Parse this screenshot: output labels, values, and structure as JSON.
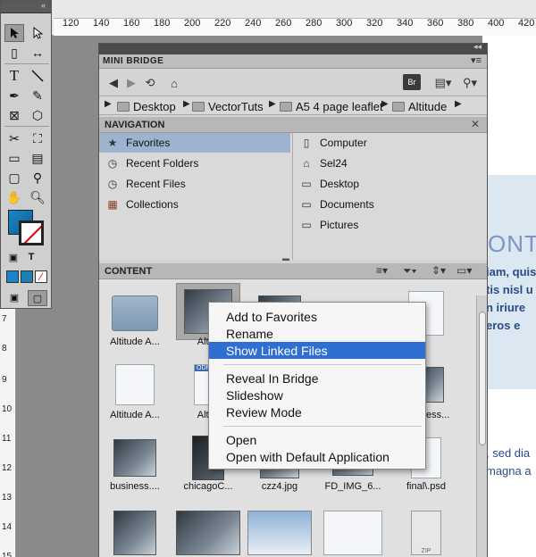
{
  "ruler": {
    "top_labels": [
      "120",
      "140",
      "160",
      "180",
      "200",
      "220",
      "240",
      "260",
      "280",
      "300",
      "320",
      "340",
      "360",
      "380",
      "400",
      "420"
    ],
    "left_labels": [
      "7",
      "8",
      "9",
      "10",
      "11",
      "12",
      "13",
      "14",
      "15"
    ]
  },
  "document": {
    "heading": "ONTO",
    "para1": [
      "iam, quis",
      "tis nisl u",
      "n iriure",
      "eros e"
    ],
    "para2": [
      ", sed dia",
      "magna a"
    ]
  },
  "tools": {
    "type_icon": "T",
    "text_icon": "T"
  },
  "mini_bridge": {
    "title": "MINI BRIDGE",
    "br_button": "Br",
    "breadcrumbs": [
      "Desktop",
      "VectorTuts",
      "A5 4 page leaflet",
      "Altitude"
    ],
    "navigation": {
      "header": "NAVIGATION",
      "left": [
        {
          "label": "Favorites",
          "icon": "star-icon",
          "selected": true
        },
        {
          "label": "Recent Folders",
          "icon": "clock-icon",
          "selected": false
        },
        {
          "label": "Recent Files",
          "icon": "clock-icon",
          "selected": false
        },
        {
          "label": "Collections",
          "icon": "collection-icon",
          "selected": false
        }
      ],
      "right": [
        {
          "label": "Computer",
          "icon": "computer-icon"
        },
        {
          "label": "Sel24",
          "icon": "user-icon"
        },
        {
          "label": "Desktop",
          "icon": "folder-icon"
        },
        {
          "label": "Documents",
          "icon": "folder-icon"
        },
        {
          "label": "Pictures",
          "icon": "folder-icon"
        }
      ]
    },
    "content": {
      "header": "CONTENT",
      "items": [
        {
          "label": "Altitude A...",
          "kind": "folder"
        },
        {
          "label": "Altitu",
          "kind": "photo",
          "selected": true
        },
        {
          "label": "",
          "kind": "photo"
        },
        {
          "label": "",
          "kind": "photo"
        },
        {
          "label": "Altitude A...",
          "kind": "doc"
        },
        {
          "label": "Altitu",
          "kind": "doc"
        },
        {
          "label": "business...",
          "kind": "photo"
        },
        {
          "label": "business....",
          "kind": "photo"
        },
        {
          "label": "chicagoC...",
          "kind": "dark"
        },
        {
          "label": "czz4.jpg",
          "kind": "photo"
        },
        {
          "label": "FD_IMG_6...",
          "kind": "photo"
        },
        {
          "label": "final\\.psd",
          "kind": "doc"
        }
      ],
      "row4_kinds": [
        "photo",
        "photo",
        "snow",
        "doc",
        "zip"
      ],
      "zip_text": "ZIP",
      "badge_odf": "ODF"
    }
  },
  "context_menu": {
    "items": [
      {
        "label": "Add to Favorites",
        "highlighted": false
      },
      {
        "label": "Rename",
        "highlighted": false
      },
      {
        "label": "Show Linked Files",
        "highlighted": true
      },
      {
        "label": "Reveal In Bridge",
        "highlighted": false
      },
      {
        "label": "Slideshow",
        "highlighted": false
      },
      {
        "label": "Review Mode",
        "highlighted": false
      },
      {
        "label": "Open",
        "highlighted": false
      },
      {
        "label": "Open with Default Application",
        "highlighted": false
      }
    ]
  },
  "colors": {
    "highlight": "#2f6fd2",
    "nav_selected": "#9db3cf",
    "doc_text": "#294a8a",
    "fill_swatch": "#1a86c8"
  }
}
